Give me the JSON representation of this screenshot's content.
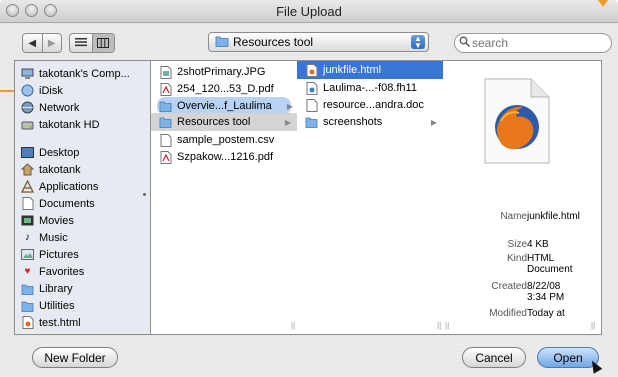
{
  "window": {
    "title": "File Upload"
  },
  "toolbar": {
    "location": "Resources tool",
    "search_placeholder": "search"
  },
  "sidebar": {
    "devices": [
      {
        "label": "takotank's Comp...",
        "icon": "computer-icon"
      },
      {
        "label": "iDisk",
        "icon": "idisk-icon"
      },
      {
        "label": "Network",
        "icon": "network-icon"
      },
      {
        "label": "takotank HD",
        "icon": "harddrive-icon"
      }
    ],
    "places": [
      {
        "label": "Desktop",
        "icon": "desktop-icon"
      },
      {
        "label": "takotank",
        "icon": "home-icon"
      },
      {
        "label": "Applications",
        "icon": "applications-icon"
      },
      {
        "label": "Documents",
        "icon": "documents-icon"
      },
      {
        "label": "Movies",
        "icon": "movies-icon"
      },
      {
        "label": "Music",
        "icon": "music-icon"
      },
      {
        "label": "Pictures",
        "icon": "pictures-icon"
      },
      {
        "label": "Favorites",
        "icon": "favorites-icon"
      },
      {
        "label": "Library",
        "icon": "library-icon"
      },
      {
        "label": "Utilities",
        "icon": "utilities-icon"
      },
      {
        "label": "test.html",
        "icon": "html-file-icon"
      }
    ]
  },
  "columns": {
    "col1": [
      {
        "label": "2shotPrimary.JPG",
        "icon": "image-file-icon"
      },
      {
        "label": "254_120...53_D.pdf",
        "icon": "pdf-file-icon"
      },
      {
        "label": "Overvie...f_Laulima",
        "icon": "folder-icon",
        "folder": true
      },
      {
        "label": "Resources tool",
        "icon": "folder-icon",
        "folder": true
      },
      {
        "label": "sample_postem.csv",
        "icon": "text-file-icon"
      },
      {
        "label": "Szpakow...1216.pdf",
        "icon": "pdf-file-icon"
      }
    ],
    "col2": [
      {
        "label": "junkfile.html",
        "icon": "html-file-icon"
      },
      {
        "label": "Laulima-...-f08.fh11",
        "icon": "freehand-file-icon"
      },
      {
        "label": "resource...andra.doc",
        "icon": "doc-file-icon"
      },
      {
        "label": "screenshots",
        "icon": "folder-icon",
        "folder": true
      }
    ]
  },
  "preview": {
    "name_label": "Name",
    "name_value": "junkfile.html",
    "size_label": "Size",
    "size_value": "4 KB",
    "kind_label": "Kind",
    "kind_value": "HTML Document",
    "created_label": "Created",
    "created_value": "8/22/08 3:34 PM",
    "modified_label": "Modified",
    "modified_value": "Today at"
  },
  "buttons": {
    "new_folder": "New Folder",
    "cancel": "Cancel",
    "open": "Open"
  },
  "colors": {
    "selection": "#3875d7",
    "path_selection": "#d4d4d4",
    "annotation": "#f09a2a"
  }
}
